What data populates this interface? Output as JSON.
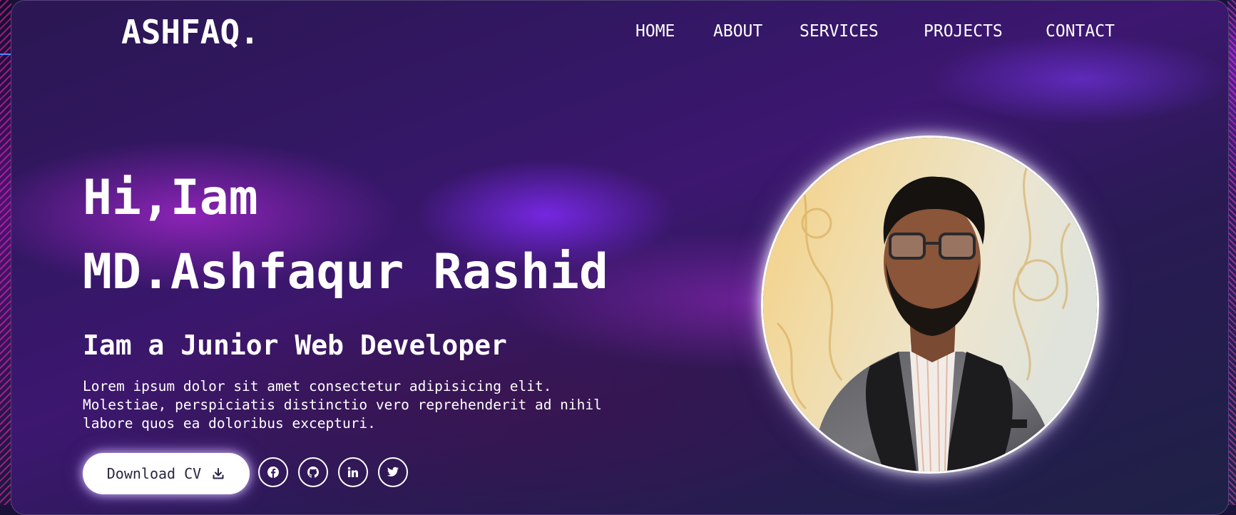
{
  "brand": {
    "logo": "ASHFAQ."
  },
  "nav": {
    "items": [
      {
        "label": "HOME"
      },
      {
        "label": "ABOUT"
      },
      {
        "label": "SERVICES"
      },
      {
        "label": "PROJECTS"
      },
      {
        "label": "CONTACT"
      }
    ]
  },
  "hero": {
    "greeting": "Hi,Iam",
    "name": "MD.Ashfaqur Rashid",
    "role": "Iam a Junior Web Developer",
    "description": "Lorem ipsum dolor sit amet consectetur adipisicing elit. Molestiae, perspiciatis distinctio vero reprehenderit ad nihil labore quos ea doloribus excepturi.",
    "cv_button": "Download CV"
  },
  "social": [
    {
      "icon": "facebook-icon"
    },
    {
      "icon": "github-icon"
    },
    {
      "icon": "linkedin-icon"
    },
    {
      "icon": "twitter-icon"
    }
  ],
  "profile": {
    "photo": "profile-photo"
  },
  "colors": {
    "background": "#2b1752",
    "accent_purple": "#7a2fe0",
    "accent_magenta": "#b02ad0",
    "text": "#ffffff",
    "button_bg": "#ffffff",
    "button_text": "#2a2540"
  }
}
